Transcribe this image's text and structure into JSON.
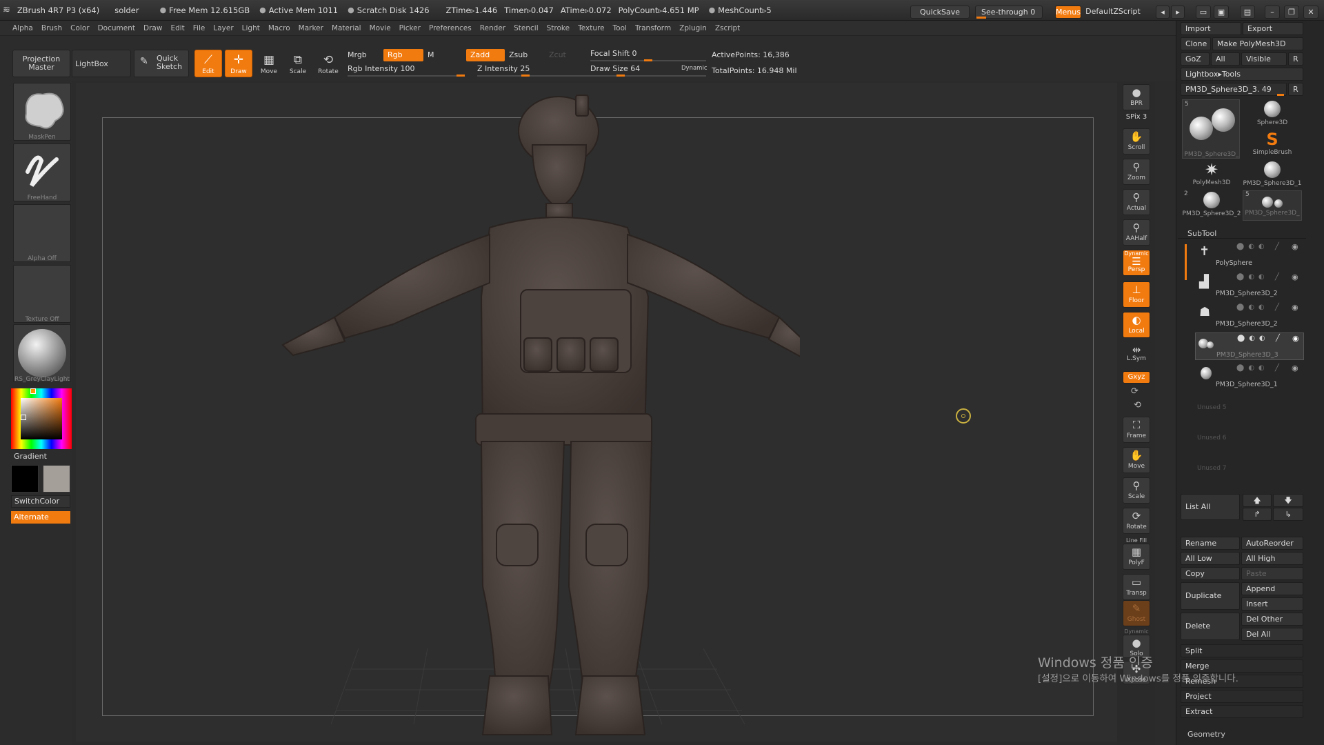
{
  "titlebar": {
    "app": "ZBrush 4R7 P3 (x64)",
    "doc": "solder",
    "free_mem": "Free Mem 12.615GB",
    "active_mem": "Active Mem 1011",
    "scratch": "Scratch Disk 1426",
    "ztime": "ZTime▹1.446",
    "timer": "Timer▹0.047",
    "atime": "ATime▹0.072",
    "polycount": "PolyCount▹4.651 MP",
    "meshcount": "MeshCount▹5",
    "quicksave": "QuickSave",
    "seethrough": "See-through  0",
    "menus": "Menus",
    "script": "DefaultZScript"
  },
  "menubar": [
    "Alpha",
    "Brush",
    "Color",
    "Document",
    "Draw",
    "Edit",
    "File",
    "Layer",
    "Light",
    "Macro",
    "Marker",
    "Material",
    "Movie",
    "Picker",
    "Preferences",
    "Render",
    "Stencil",
    "Stroke",
    "Texture",
    "Tool",
    "Transform",
    "Zplugin",
    "Zscript"
  ],
  "toolbar": {
    "projection_master": "Projection Master",
    "lightbox": "LightBox",
    "quick_sketch": "Quick Sketch",
    "edit": "Edit",
    "draw": "Draw",
    "move": "Move",
    "scale": "Scale",
    "rotate": "Rotate",
    "mrgb": "Mrgb",
    "rgb": "Rgb",
    "m": "M",
    "zadd": "Zadd",
    "zsub": "Zsub",
    "zcut": "Zcut",
    "rgb_intensity": "Rgb  Intensity 100",
    "z_intensity": "Z Intensity 25",
    "focal_shift": "Focal  Shift 0",
    "draw_size": "Draw  Size 64",
    "dynamic": "Dynamic",
    "active_points": "ActivePoints: 16,386",
    "total_points": "TotalPoints: 16.948  Mil"
  },
  "leftshelf": {
    "maskpen": "MaskPen",
    "freehand": "FreeHand",
    "alpha_off": "Alpha  Off",
    "texture_off": "Texture  Off",
    "material": "RS_GreyClayLight",
    "gradient": "Gradient",
    "switchcolor": "SwitchColor",
    "alternate": "Alternate"
  },
  "rightshelf": {
    "bpr": "BPR",
    "spix": "SPix 3",
    "scroll": "Scroll",
    "zoom": "Zoom",
    "actual": "Actual",
    "aahalf": "AAHalf",
    "dynamic": "Dynamic",
    "persp": "Persp",
    "floor": "Floor",
    "local": "Local",
    "lsym": "L.Sym",
    "xyz": "Gxyz",
    "frame": "Frame",
    "move": "Move",
    "scale": "Scale",
    "rotate": "Rotate",
    "linefill": "Line Fill",
    "polyf": "PolyF",
    "transp": "Transp",
    "ghost": "Ghost",
    "dynamic2": "Dynamic",
    "solo": "Solo",
    "xpose": "Xpose"
  },
  "rightpanel": {
    "import": "Import",
    "export": "Export",
    "clone": "Clone",
    "make_polymesh": "Make PolyMesh3D",
    "goz": "GoZ",
    "all": "All",
    "visible": "Visible",
    "r": "R",
    "lightbox_tools": "Lightbox▸Tools",
    "current_tool": "PM3D_Sphere3D_3. 49",
    "tools": [
      {
        "name": "PM3D_Sphere3D_",
        "count": "5"
      },
      {
        "name": "Sphere3D",
        "count": ""
      },
      {
        "name": "SimpleBrush",
        "count": ""
      },
      {
        "name": "PolyMesh3D",
        "count": ""
      },
      {
        "name": "PM3D_Sphere3D_1",
        "count": ""
      },
      {
        "name": "PM3D_Sphere3D_2",
        "count": "2"
      },
      {
        "name": "PM3D_Sphere3D_",
        "count": "5"
      }
    ],
    "subtool_header": "SubTool",
    "subtools": [
      "PolySphere",
      "PM3D_Sphere3D_2",
      "PM3D_Sphere3D_2",
      "PM3D_Sphere3D_3",
      "PM3D_Sphere3D_1"
    ],
    "unused": [
      "Unused  5",
      "Unused  6",
      "Unused  7"
    ],
    "list_all": "List  All",
    "rename": "Rename",
    "autoreorder": "AutoReorder",
    "all_low": "All  Low",
    "all_high": "All  High",
    "copy": "Copy",
    "paste": "Paste",
    "duplicate": "Duplicate",
    "append": "Append",
    "insert": "Insert",
    "delete": "Delete",
    "del_other": "Del  Other",
    "del_all": "Del  All",
    "split": "Split",
    "merge": "Merge",
    "remesh": "Remesh",
    "project": "Project",
    "extract": "Extract",
    "geometry": "Geometry"
  },
  "watermark": {
    "line1": "Windows 정품 인증",
    "line2": "[설정]으로 이동하여 Windows를 정품 인증합니다."
  },
  "colors": {
    "accent": "#f27b10",
    "panel": "#262626",
    "viewport": "#2e2e2e",
    "model": "#4a403c"
  }
}
